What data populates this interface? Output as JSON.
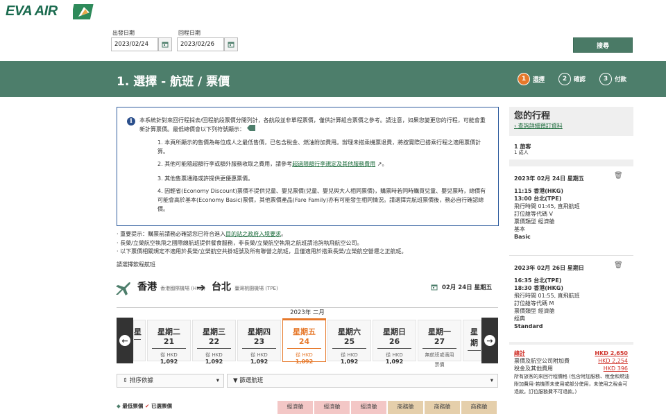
{
  "brand": {
    "name": "EVA AIR"
  },
  "search": {
    "depart_label": "出發日期",
    "depart_value": "2023/02/24",
    "return_label": "回程日期",
    "return_value": "2023/02/26",
    "search_button": "搜尋"
  },
  "header": {
    "title": "1. 選擇 - 航班 / 票價",
    "steps": [
      {
        "num": "1",
        "label": "選擇",
        "active": true
      },
      {
        "num": "2",
        "label": "確認",
        "active": false
      },
      {
        "num": "3",
        "label": "付款",
        "active": false
      }
    ]
  },
  "notice": {
    "intro": "本系統針對來回行程採去/回程航段票價分開列計，各航段並非單程票價，僅供計算組合票價之參考。請注意，如果您變更您的行程，可能會重新計算票價。最低總價會以下列符號顯示：",
    "items": [
      "1. 本頁所顯示的售價為每位成人之最低售價，已包含稅金、燃油附加費用。辦理未搭乘機票退費，將按實際已搭乘行程之適用票價計算。",
      "2. 其他可能隨超額行李或額外服務收取之費用，請參考",
      "3. 其他售票通路或許提供更優惠票價。",
      "4. 因輕省(Economy Discount)票價不提供兒童、嬰兒票價(兒童、嬰兒與大人相同票價)，購票時若同時購買兒童、嬰兒票時，總價有可能會高於基本(Economy Basic)票價，其他票價產品(Fare Family)亦有可能發生相同情況。請選擇完航班票價後，務必自行確認總價。"
    ],
    "item2_link": "超過限額行李規定及其他服務費用",
    "item2_end": "。"
  },
  "bullets": {
    "b1_prefix": "· 重要提示：購票前請務必確認您已符合進入",
    "b1_link": "目的站之政府入境要求",
    "b1_suffix": "。",
    "b2": "· 長榮/立榮航空執飛之國際線航班提供餐食服務，非長榮/立榮航空執飛之航班請洽詢執飛航空公司。",
    "b3": "· 以下票價相關規定不適用於長榮/立榮航空共掛班號及所有聯營之航班，且僅適用於搭乘長榮/立榮航空營運之正航班。",
    "choose": "請選擇飲程航班"
  },
  "route": {
    "from_city": "香港",
    "from_airport": "香港國際機場 (HKG)",
    "to_city": "台北",
    "to_airport": "臺灣桃園機場 (TPE)",
    "date": "02月 24日 星期五"
  },
  "calendar": {
    "month": "2023年 二月",
    "days": [
      {
        "name": "星期二 21",
        "from": "從 HKD",
        "price": "1,092",
        "state": "normal"
      },
      {
        "name": "星期三 22",
        "from": "從 HKD",
        "price": "1,092",
        "state": "normal"
      },
      {
        "name": "星期四 23",
        "from": "從 HKD",
        "price": "1,092",
        "state": "normal"
      },
      {
        "name": "星期五 24",
        "from": "從 HKD",
        "price": "1,092",
        "state": "selected"
      },
      {
        "name": "星期六 25",
        "from": "從 HKD",
        "price": "1,092",
        "state": "normal"
      },
      {
        "name": "星期日 26",
        "from": "從 HKD",
        "price": "1,092",
        "state": "normal"
      },
      {
        "name": "星期一 27",
        "from": "無航班或適用",
        "price": "票價",
        "state": "na"
      }
    ],
    "left_peek": "星",
    "right_peek": "星期"
  },
  "filters": {
    "sort": "排序依據",
    "filter": "篩選航班",
    "legend_low": "最低票價",
    "legend_sel": "已選票價",
    "cabin_headers": [
      "經濟艙",
      "經濟艙",
      "經濟艙",
      "商務艙",
      "商務艙",
      "商務艙"
    ]
  },
  "sidebar": {
    "title": "您的行程",
    "link": "查詢詳細預訂資料",
    "pax": "1 旅客",
    "pax_sub": "1 成人",
    "outbound": {
      "date": "2023年 02月 24日 星期五",
      "dep": "11:15 香港(HKG)",
      "arr": "13:00 台北(TPE)",
      "dur": "飛行時間 01:45, 直飛航班",
      "cls": "訂位艙等代碼 V",
      "type": "票價類型 經濟艙",
      "fam": "基本",
      "fam_en": "Basic"
    },
    "inbound": {
      "date": "2023年 02月 26日 星期日",
      "dep": "16:35 台北(TPE)",
      "arr": "18:30 香港(HKG)",
      "dur": "飛行時間 01:55, 直飛航班",
      "cls": "訂位艙等代碼 M",
      "type": "票價類型 經濟艙",
      "fam": "經典",
      "fam_en": "Standard"
    },
    "total_label": "總計",
    "total": "HKD 2,650",
    "fare_label": "票價及航空公司附加費",
    "fare": "HKD 2,254",
    "tax_label": "稅金及其他費用",
    "tax": "HKD 396",
    "note": "所有旅客的來回行程價格 (包含附加服務、稅金和燃油附加費用-若機票未使用或部分使用，未使用之稅金可退款。訂位服務費不可退款。)"
  },
  "colors": {
    "brand_green": "#4d7e6b",
    "accent_orange": "#e6782a",
    "total_red": "#d0342c"
  }
}
